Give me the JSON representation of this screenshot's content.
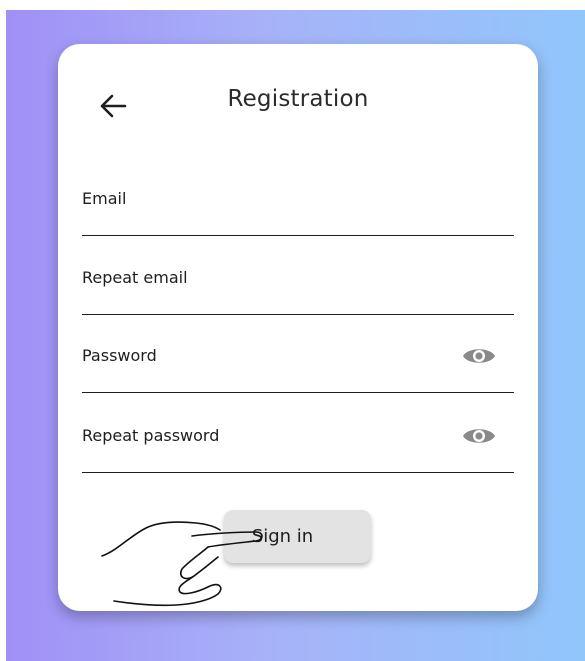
{
  "header": {
    "title": "Registration",
    "back_icon": "arrow-left-icon"
  },
  "form": {
    "fields": [
      {
        "label": "Email"
      },
      {
        "label": "Repeat email"
      },
      {
        "label": "Password",
        "icon": "eye-icon"
      },
      {
        "label": "Repeat password",
        "icon": "eye-icon"
      }
    ],
    "submit_label": "Sign in"
  },
  "colors": {
    "gradient_start": "#a090f6",
    "gradient_end": "#91c6fb",
    "card": "#ffffff",
    "button": "#e3e3e3",
    "eye_icon": "#8a8a8a"
  },
  "decor": {
    "pointer_icon": "hand-pointer-icon"
  }
}
